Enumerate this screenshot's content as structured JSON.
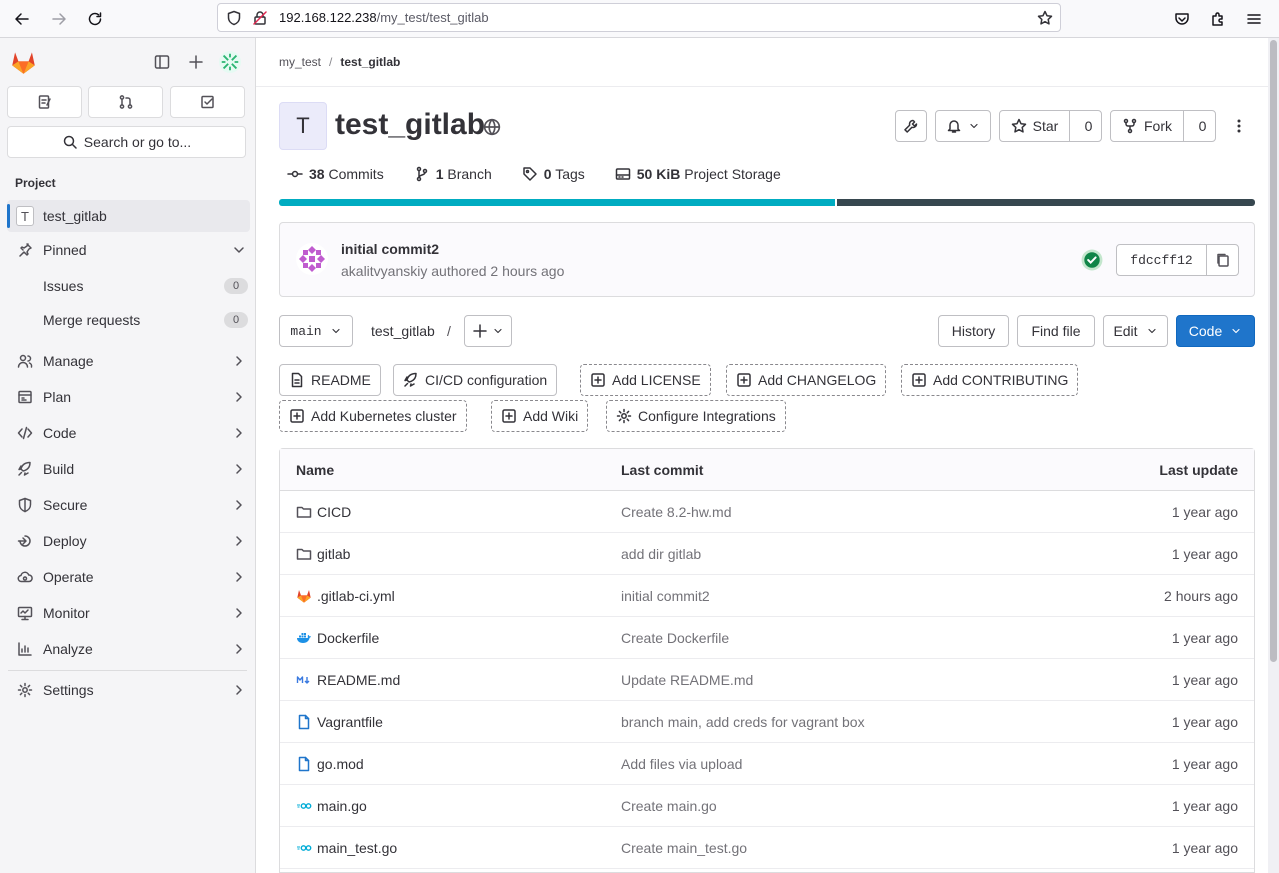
{
  "browser": {
    "url_host": "192.168.122.238",
    "url_path": "/my_test/test_gitlab"
  },
  "sidebar": {
    "search_label": "Search or go to...",
    "section_title": "Project",
    "project_item": {
      "letter": "T",
      "label": "test_gitlab"
    },
    "pinned_label": "Pinned",
    "pinned_items": [
      {
        "label": "Issues",
        "count": "0"
      },
      {
        "label": "Merge requests",
        "count": "0"
      }
    ],
    "nav_items": [
      {
        "label": "Manage",
        "icon": "users-icon"
      },
      {
        "label": "Plan",
        "icon": "planning-icon"
      },
      {
        "label": "Code",
        "icon": "code-icon"
      },
      {
        "label": "Build",
        "icon": "rocket-icon"
      },
      {
        "label": "Secure",
        "icon": "shield-icon"
      },
      {
        "label": "Deploy",
        "icon": "deploy-icon"
      },
      {
        "label": "Operate",
        "icon": "cloud-icon"
      },
      {
        "label": "Monitor",
        "icon": "monitor-icon"
      },
      {
        "label": "Analyze",
        "icon": "chart-icon"
      }
    ],
    "settings_label": "Settings"
  },
  "breadcrumb": {
    "parent": "my_test",
    "current": "test_gitlab"
  },
  "project": {
    "avatar_letter": "T",
    "title": "test_gitlab",
    "star_label": "Star",
    "star_count": "0",
    "fork_label": "Fork",
    "fork_count": "0"
  },
  "stats": {
    "commits_count": "38",
    "commits_label": "Commits",
    "branches_count": "1",
    "branches_label": "Branch",
    "tags_count": "0",
    "tags_label": "Tags",
    "storage_size": "50 KiB",
    "storage_label": "Project Storage",
    "language_bar": [
      {
        "color": "#00acc1",
        "share": 0.57
      },
      {
        "color": "#37474f",
        "share": 0.43
      }
    ]
  },
  "last_commit": {
    "message": "initial commit2",
    "meta": "akalitvyanskiy authored 2 hours ago",
    "sha": "fdccff12",
    "pipeline_status_color": "#108548"
  },
  "repo_toolbar": {
    "branch": "main",
    "path": "test_gitlab",
    "separator": "/",
    "history_label": "History",
    "find_file_label": "Find file",
    "edit_label": "Edit",
    "code_label": "Code",
    "accent_color": "#1f75cb"
  },
  "shortcuts": {
    "readme": "README",
    "cicd": "CI/CD configuration",
    "license": "Add LICENSE",
    "changelog": "Add CHANGELOG",
    "contributing": "Add CONTRIBUTING",
    "kubernetes": "Add Kubernetes cluster",
    "wiki": "Add Wiki",
    "integrations": "Configure Integrations"
  },
  "file_table": {
    "headers": {
      "name": "Name",
      "last_commit": "Last commit",
      "last_update": "Last update"
    },
    "rows": [
      {
        "name": "CICD",
        "icon": "folder-icon",
        "commit": "Create 8.2-hw.md",
        "updated": "1 year ago"
      },
      {
        "name": "gitlab",
        "icon": "folder-icon",
        "commit": "add dir gitlab",
        "updated": "1 year ago"
      },
      {
        "name": ".gitlab-ci.yml",
        "icon": "gitlab-icon",
        "commit": "initial commit2",
        "updated": "2 hours ago"
      },
      {
        "name": "Dockerfile",
        "icon": "docker-icon",
        "commit": "Create Dockerfile",
        "updated": "1 year ago"
      },
      {
        "name": "README.md",
        "icon": "markdown-icon",
        "commit": "Update README.md",
        "updated": "1 year ago"
      },
      {
        "name": "Vagrantfile",
        "icon": "file-icon",
        "commit": "branch main, add creds for vagrant box",
        "updated": "1 year ago"
      },
      {
        "name": "go.mod",
        "icon": "file-icon",
        "commit": "Add files via upload",
        "updated": "1 year ago"
      },
      {
        "name": "main.go",
        "icon": "go-icon",
        "commit": "Create main.go",
        "updated": "1 year ago"
      },
      {
        "name": "main_test.go",
        "icon": "go-icon",
        "commit": "Create main_test.go",
        "updated": "1 year ago"
      }
    ]
  }
}
